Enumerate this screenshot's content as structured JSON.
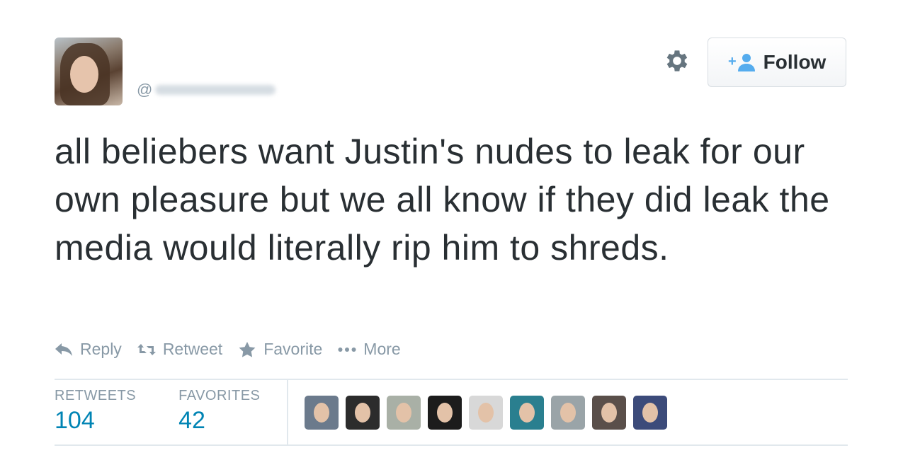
{
  "user": {
    "handle_prefix": "@"
  },
  "follow_button": {
    "label": "Follow"
  },
  "tweet": {
    "text": "all beliebers want Justin's nudes to leak for our own pleasure but we all know if they did leak the media would literally rip him to shreds."
  },
  "actions": [
    {
      "label": "Reply",
      "icon": "reply-icon"
    },
    {
      "label": "Retweet",
      "icon": "retweet-icon"
    },
    {
      "label": "Favorite",
      "icon": "star-icon"
    },
    {
      "label": "More",
      "icon": "more-dots-icon"
    }
  ],
  "stats": {
    "retweets_label": "RETWEETS",
    "retweets_value": "104",
    "favorites_label": "FAVORITES",
    "favorites_value": "42"
  },
  "colors": {
    "link_blue": "#0084b4",
    "muted_gray": "#8899a6",
    "text": "#292f33",
    "follow_icon_blue": "#55acee"
  },
  "favoriter_avatars": [
    {
      "bg": "#6b7a8c"
    },
    {
      "bg": "#2c2c2c"
    },
    {
      "bg": "#a9b0a6"
    },
    {
      "bg": "#1c1c1c"
    },
    {
      "bg": "#d8d8d8"
    },
    {
      "bg": "#2a7f8f"
    },
    {
      "bg": "#9aa4a8"
    },
    {
      "bg": "#5a4f4a"
    },
    {
      "bg": "#3c4b7a"
    }
  ]
}
